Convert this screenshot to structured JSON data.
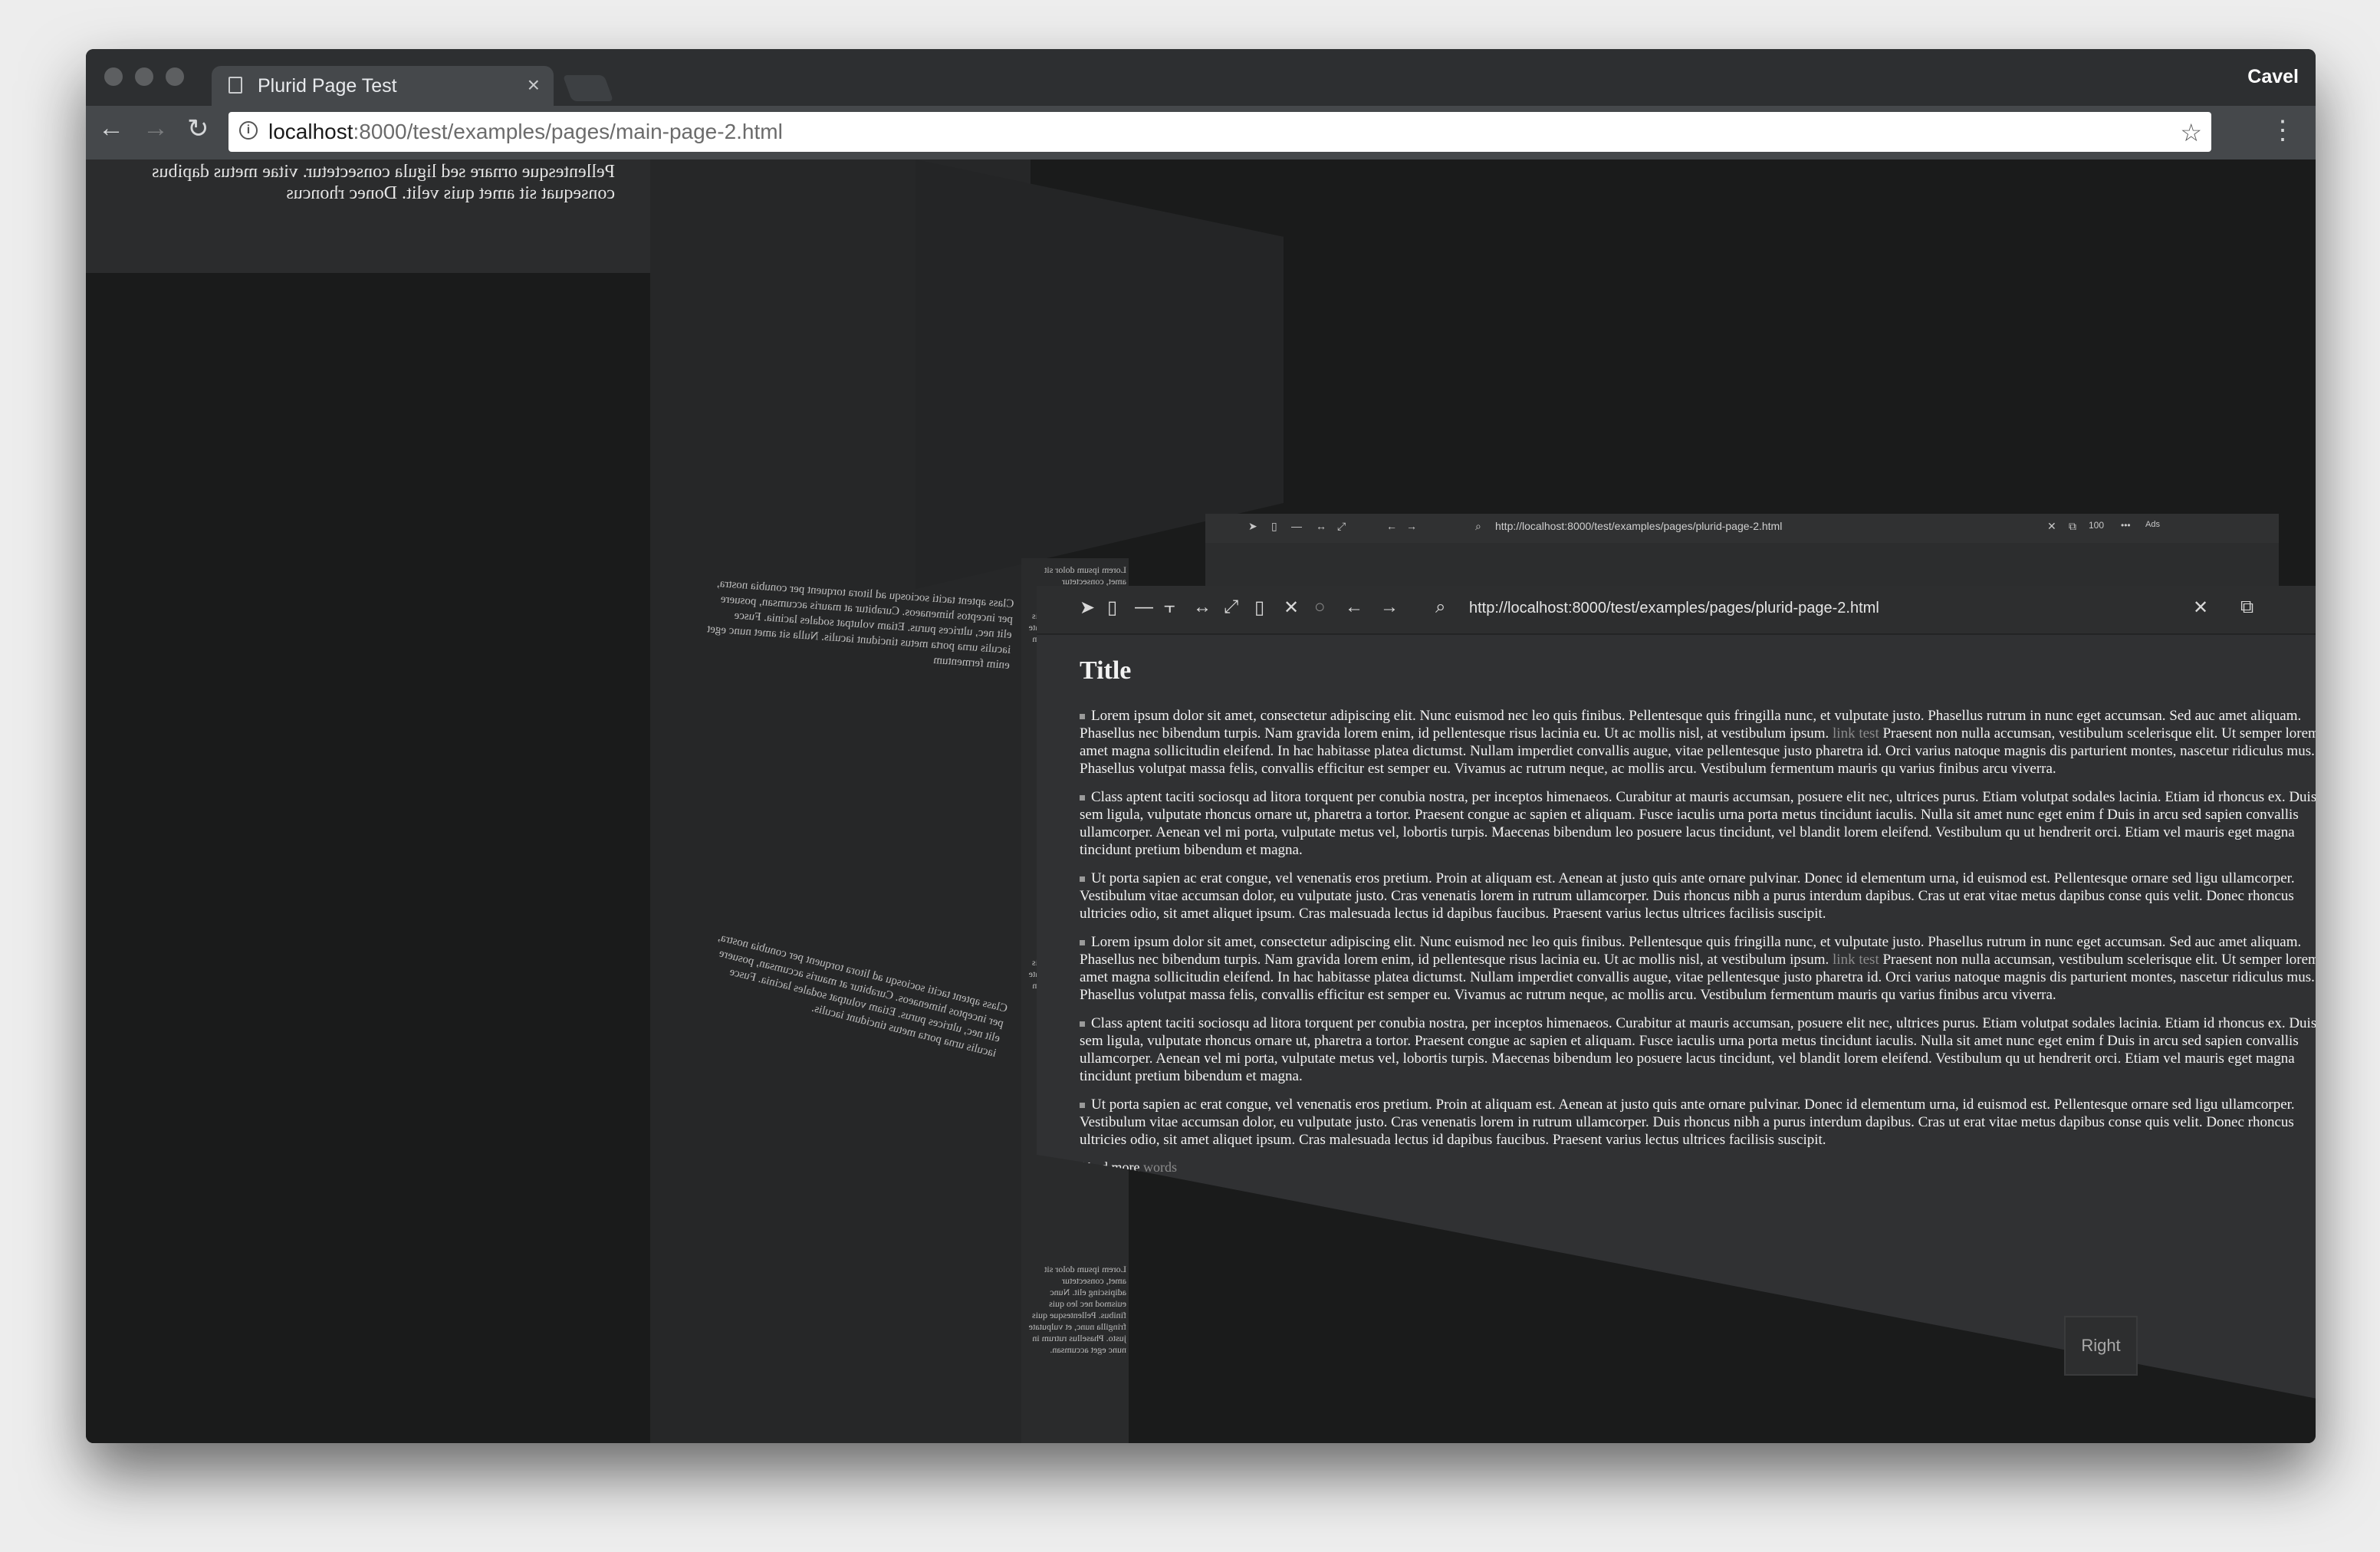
{
  "window": {
    "tab_title": "Plurid Page Test",
    "tab_close": "×",
    "profile_name": "Cavel"
  },
  "toolbar": {
    "back_icon": "←",
    "forward_icon": "→",
    "reload_icon": "↻",
    "info_icon": "i",
    "url_host": "localhost",
    "url_rest": ":8000/test/examples/pages/main-page-2.html",
    "star_icon": "☆",
    "menu_icon": "⋮"
  },
  "scene": {
    "top_left_text": "Pellentesque ornare sed ligula consectetur. vitae metus dapibus consequat sit amet quis velit. Donec rhoncus",
    "back_plane_url": "http://localhost:8000/test/examples/pages/plurid-page-2.html",
    "back_plane_zoom": "100",
    "back_plane_more": "•••",
    "back_plane_label": "Ads",
    "front_plane_url": "http://localhost:8000/test/examples/pages/plurid-page-2.html",
    "front_close_icon": "✕",
    "front_copy_icon": "⧉",
    "right_button": "Right",
    "mirror_block_1": "Class aptent taciti sociosqu ad litora torquent per conubia nostra, per inceptos himenaeos. Curabitur at mauris accumsan, posuere elit nec, ultrices purus. Etiam volutpat sodales lacinia. Fusce iaculis urna porta metus tincidunt iaculis. Nulla sit amet nunc eget enim fermentum",
    "mirror_block_2": "Class aptent taciti sociosqu ad litora torquent per conubia nostra, per inceptos himenaeos. Curabitur at mauris accumsan, posuere elit nec, ultrices purus. Etiam volutpat sodales lacinia. Fusce iaculis urna porta metus tincidunt iaculis.",
    "strip_text": "Lorem ipsum dolor sit amet, consectetur adipiscing elit. Nunc euismod nec leo quis finibus. Pellentesque quis fringilla nunc, et vulputate justo. Phasellus rutrum in nunc eget accumsan."
  },
  "page": {
    "title": "Title",
    "paragraphs": [
      {
        "pre": "Lorem ipsum dolor sit amet, consectetur adipiscing elit. Nunc euismod nec leo quis finibus. Pellentesque quis fringilla nunc, et vulputate justo. Phasellus rutrum in nunc eget accumsan. Sed auc amet aliquam. Phasellus nec bibendum turpis. Nam gravida lorem enim, id pellentesque risus lacinia eu. Ut ac mollis nisl, at vestibulum ipsum.",
        "link": "link test",
        "post": "Praesent non nulla accumsan, vestibulum scelerisque elit. Ut semper lorem sit amet magna sollicitudin eleifend. In hac habitasse platea dictumst. Nullam imperdiet convallis augue, vitae pellentesque justo pharetra id. Orci varius natoque magnis dis parturient montes, nascetur ridiculus mus. Phasellus volutpat massa felis, convallis efficitur est semper eu. Vivamus ac rutrum neque, ac mollis arcu. Vestibulum fermentum mauris qu varius finibus arcu viverra."
      },
      {
        "pre": "Class aptent taciti sociosqu ad litora torquent per conubia nostra, per inceptos himenaeos. Curabitur at mauris accumsan, posuere elit nec, ultrices purus. Etiam volutpat sodales lacinia. Etiam id rhoncus ex. Duis sem ligula, vulputate rhoncus ornare ut, pharetra a tortor. Praesent congue ac sapien et aliquam. Fusce iaculis urna porta metus tincidunt iaculis. Nulla sit amet nunc eget enim f Duis in arcu sed sapien convallis ullamcorper. Aenean vel mi porta, vulputate metus vel, lobortis turpis. Maecenas bibendum leo posuere lacus tincidunt, vel blandit lorem eleifend. Vestibulum qu ut hendrerit orci. Etiam vel mauris eget magna tincidunt pretium bibendum et magna.",
        "link": "",
        "post": ""
      },
      {
        "pre": "Ut porta sapien ac erat congue, vel venenatis eros pretium. Proin at aliquam est. Aenean at justo quis ante ornare pulvinar. Donec id elementum urna, id euismod est. Pellentesque ornare sed ligu ullamcorper. Vestibulum vitae accumsan dolor, eu vulputate justo. Cras venenatis lorem in rutrum ullamcorper. Duis rhoncus nibh a purus interdum dapibus. Cras ut erat vitae metus dapibus conse quis velit. Donec rhoncus ultricies odio, sit amet aliquet ipsum. Cras malesuada lectus id dapibus faucibus. Praesent varius lectus ultrices facilisis suscipit.",
        "link": "",
        "post": ""
      },
      {
        "pre": "Lorem ipsum dolor sit amet, consectetur adipiscing elit. Nunc euismod nec leo quis finibus. Pellentesque quis fringilla nunc, et vulputate justo. Phasellus rutrum in nunc eget accumsan. Sed auc amet aliquam. Phasellus nec bibendum turpis. Nam gravida lorem enim, id pellentesque risus lacinia eu. Ut ac mollis nisl, at vestibulum ipsum.",
        "link": "link test",
        "post": "Praesent non nulla accumsan, vestibulum scelerisque elit. Ut semper lorem sit amet magna sollicitudin eleifend. In hac habitasse platea dictumst. Nullam imperdiet convallis augue, vitae pellentesque justo pharetra id. Orci varius natoque magnis dis parturient montes, nascetur ridiculus mus. Phasellus volutpat massa felis, convallis efficitur est semper eu. Vivamus ac rutrum neque, ac mollis arcu. Vestibulum fermentum mauris qu varius finibus arcu viverra."
      },
      {
        "pre": "Class aptent taciti sociosqu ad litora torquent per conubia nostra, per inceptos himenaeos. Curabitur at mauris accumsan, posuere elit nec, ultrices purus. Etiam volutpat sodales lacinia. Etiam id rhoncus ex. Duis sem ligula, vulputate rhoncus ornare ut, pharetra a tortor. Praesent congue ac sapien et aliquam. Fusce iaculis urna porta metus tincidunt iaculis. Nulla sit amet nunc eget enim f Duis in arcu sed sapien convallis ullamcorper. Aenean vel mi porta, vulputate metus vel, lobortis turpis. Maecenas bibendum leo posuere lacus tincidunt, vel blandit lorem eleifend. Vestibulum qu ut hendrerit orci. Etiam vel mauris eget magna tincidunt pretium bibendum et magna.",
        "link": "",
        "post": ""
      },
      {
        "pre": "Ut porta sapien ac erat congue, vel venenatis eros pretium. Proin at aliquam est. Aenean at justo quis ante ornare pulvinar. Donec id elementum urna, id euismod est. Pellentesque ornare sed ligu ullamcorper. Vestibulum vitae accumsan dolor, eu vulputate justo. Cras venenatis lorem in rutrum ullamcorper. Duis rhoncus nibh a purus interdum dapibus. Cras ut erat vitae metus dapibus conse quis velit. Donec rhoncus ultricies odio, sit amet aliquet ipsum. Cras malesuada lectus id dapibus faucibus. Praesent varius lectus ultrices facilisis suscipit.",
        "link": "",
        "post": ""
      }
    ],
    "more_pre": "(And more",
    "more_link": "words"
  }
}
